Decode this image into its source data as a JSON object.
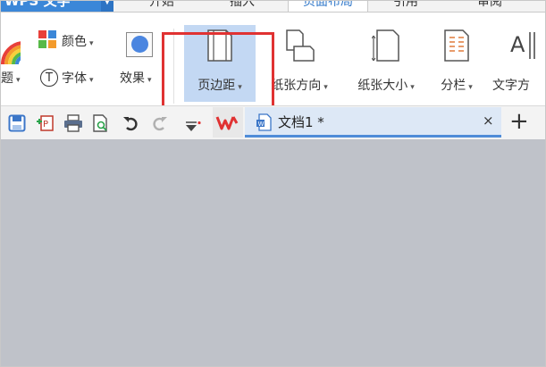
{
  "app": {
    "title": "WPS 文字",
    "menu_caret": "▼"
  },
  "menu_tabs": [
    {
      "label": "开始",
      "active": false
    },
    {
      "label": "插入",
      "active": false
    },
    {
      "label": "页面布局",
      "active": true
    },
    {
      "label": "引用",
      "active": false
    },
    {
      "label": "审阅",
      "active": false
    }
  ],
  "ribbon": {
    "theme_label": "题",
    "color_label": "颜色",
    "font_label": "字体",
    "effect_label": "效果",
    "margin_label": "页边距",
    "orientation_label": "纸张方向",
    "size_label": "纸张大小",
    "columns_label": "分栏",
    "text_direction_label": "文字方",
    "dropdown_glyph": "▾",
    "font_icon_glyph": "T"
  },
  "quick_access": {
    "icons": [
      "save-icon",
      "convert-icon",
      "print-icon",
      "print-preview-icon",
      "undo-icon",
      "redo-icon",
      "customize-dropdown-icon"
    ]
  },
  "document_tab": {
    "name": "文档1 *",
    "close_glyph": "×",
    "new_tab_glyph": "+"
  },
  "colors": {
    "accent": "#3b87d8",
    "selected_bg": "#c3d8f3",
    "highlight_red": "#e03232",
    "workspace": "#bfc2c9"
  }
}
